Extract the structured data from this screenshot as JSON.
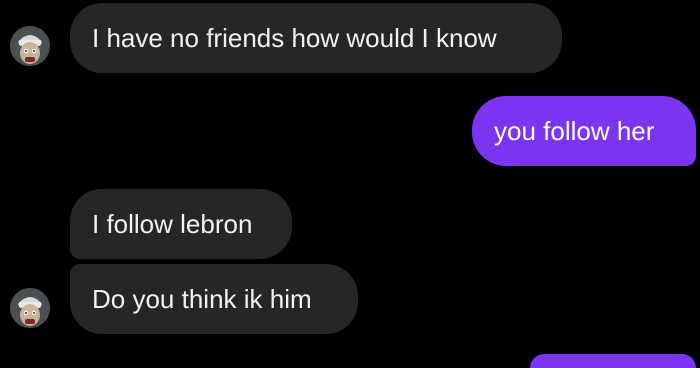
{
  "conversation": {
    "messages": [
      {
        "sender": "other",
        "text": "I have no friends how would I know",
        "avatar": "cartoon-character-avatar"
      },
      {
        "sender": "me",
        "text": "you follow her"
      },
      {
        "sender": "other",
        "text": "I follow lebron"
      },
      {
        "sender": "other",
        "text": "Do you think ik him",
        "avatar": "cartoon-character-avatar"
      },
      {
        "sender": "me",
        "text": ""
      }
    ]
  },
  "colors": {
    "background": "#000000",
    "incoming_bubble": "#262626",
    "outgoing_bubble": "#7b35f0",
    "text": "#f2f2f2"
  }
}
